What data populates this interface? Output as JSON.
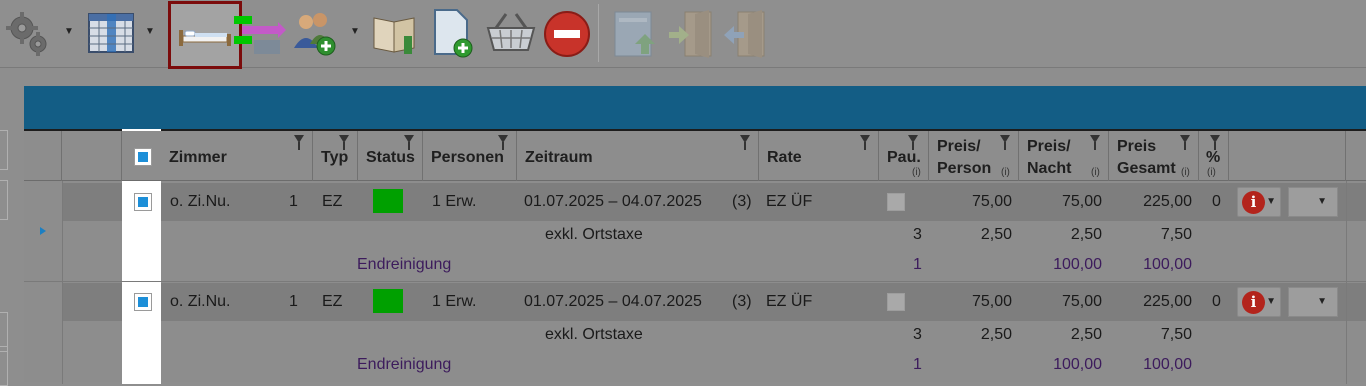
{
  "toolbar": {
    "buttons": [
      "settings-gear-icon",
      "grid-columns-icon",
      "bed-icon",
      "room-move-icon",
      "add-guests-icon",
      "book-icon",
      "new-document-icon",
      "basket-icon",
      "stop-icon",
      "checkin-icon",
      "door-exit-icon",
      "door-enter-icon"
    ]
  },
  "grid": {
    "columns": {
      "zimmer": "Zimmer",
      "typ": "Typ",
      "status": "Status",
      "personen": "Personen",
      "zeitraum": "Zeitraum",
      "rate": "Rate",
      "pau": "Pau.",
      "pau_i": "(i)",
      "preis_person_1": "Preis/",
      "preis_person_2": "Person",
      "preis_person_i": "(i)",
      "preis_nacht_1": "Preis/",
      "preis_nacht_2": "Nacht",
      "preis_nacht_i": "(i)",
      "preis_gesamt_1": "Preis",
      "preis_gesamt_2": "Gesamt",
      "preis_gesamt_i": "(i)",
      "prozent": "%",
      "prozent_i": "(i)"
    },
    "rows": [
      {
        "zimmer": "o. Zi.Nu.",
        "anzahl": "1",
        "typ": "EZ",
        "status_color": "#00a000",
        "personen": "1 Erw.",
        "zeitraum": "01.07.2025 – 04.07.2025",
        "naechte": "(3)",
        "rate": "EZ ÜF",
        "preis_person": "75,00",
        "preis_nacht": "75,00",
        "preis_gesamt": "225,00",
        "prozent": "0",
        "sub1": {
          "label": "exkl. Ortstaxe",
          "qty": "3",
          "preis_person": "2,50",
          "preis_nacht": "2,50",
          "preis_gesamt": "7,50"
        },
        "sub2": {
          "label": "Endreinigung",
          "qty": "1",
          "preis_nacht": "100,00",
          "preis_gesamt": "100,00"
        }
      },
      {
        "zimmer": "o. Zi.Nu.",
        "anzahl": "1",
        "typ": "EZ",
        "status_color": "#00a000",
        "personen": "1 Erw.",
        "zeitraum": "01.07.2025 – 04.07.2025",
        "naechte": "(3)",
        "rate": "EZ ÜF",
        "preis_person": "75,00",
        "preis_nacht": "75,00",
        "preis_gesamt": "225,00",
        "prozent": "0",
        "sub1": {
          "label": "exkl. Ortstaxe",
          "qty": "3",
          "preis_person": "2,50",
          "preis_nacht": "2,50",
          "preis_gesamt": "7,50"
        },
        "sub2": {
          "label": "Endreinigung",
          "qty": "1",
          "preis_nacht": "100,00",
          "preis_gesamt": "100,00"
        }
      }
    ]
  },
  "colors": {
    "header_band": "#135d85",
    "active_frame": "#7b0b0b",
    "info_red": "#b3241c",
    "checkbox_blue": "#1d8fd8",
    "purple_text": "#3c1b5c"
  }
}
